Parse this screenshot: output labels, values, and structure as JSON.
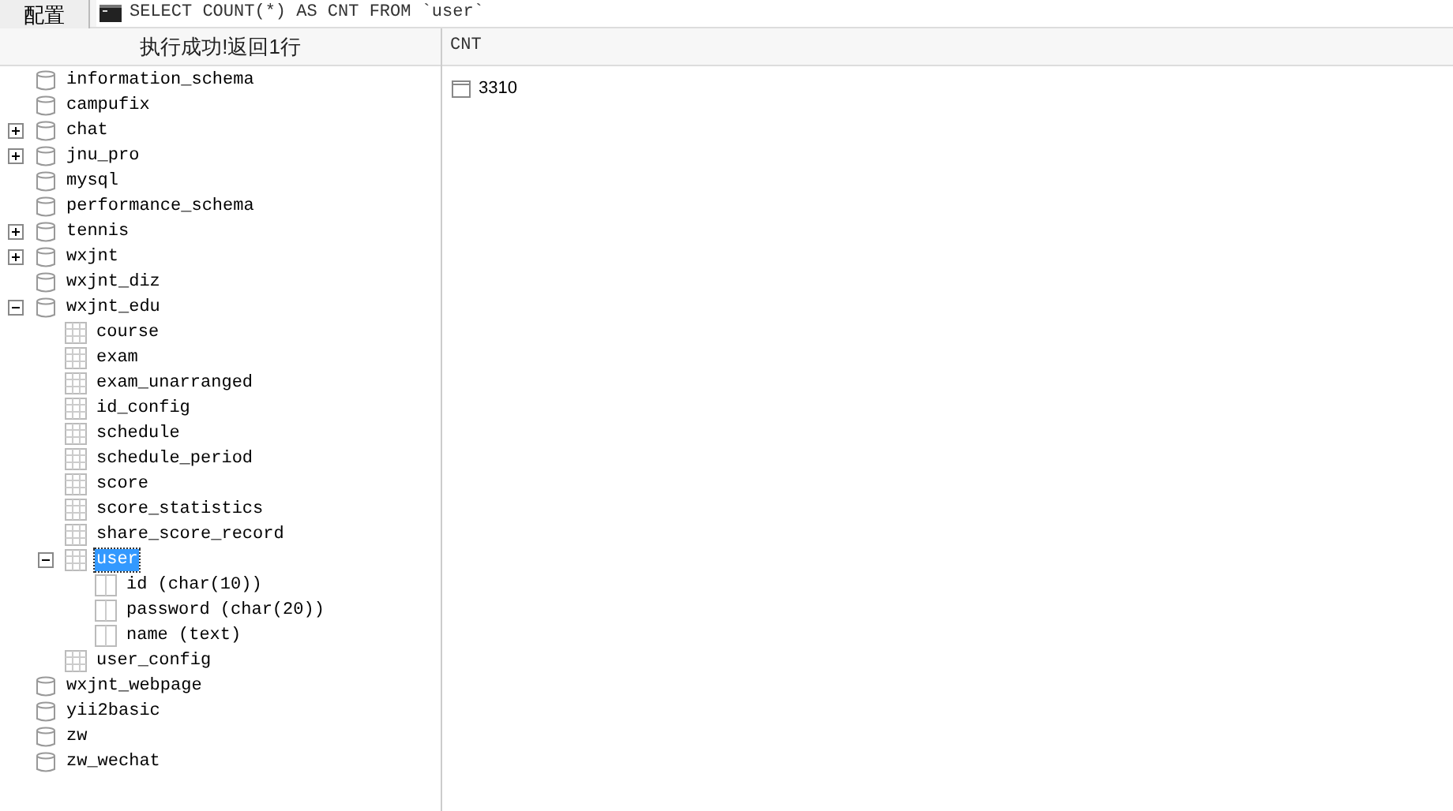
{
  "toolbar": {
    "config_button": "配置",
    "query": "SELECT COUNT(*) AS CNT FROM `user`"
  },
  "status": "执行成功!返回1行",
  "tree": [
    {
      "kind": "database",
      "label": "information_schema",
      "selected": false
    },
    {
      "kind": "database",
      "label": "campufix",
      "selected": false
    },
    {
      "kind": "database",
      "label": "chat",
      "selected": false,
      "expanded": false
    },
    {
      "kind": "database",
      "label": "jnu_pro",
      "selected": false,
      "expanded": false
    },
    {
      "kind": "database",
      "label": "mysql",
      "selected": false
    },
    {
      "kind": "database",
      "label": "performance_schema",
      "selected": false
    },
    {
      "kind": "database",
      "label": "tennis",
      "selected": false,
      "expanded": false
    },
    {
      "kind": "database",
      "label": "wxjnt",
      "selected": false,
      "expanded": false
    },
    {
      "kind": "database",
      "label": "wxjnt_diz",
      "selected": false
    },
    {
      "kind": "database",
      "label": "wxjnt_edu",
      "selected": false,
      "expanded": true,
      "children": [
        {
          "kind": "table",
          "label": "course",
          "selected": false
        },
        {
          "kind": "table",
          "label": "exam",
          "selected": false
        },
        {
          "kind": "table",
          "label": "exam_unarranged",
          "selected": false
        },
        {
          "kind": "table",
          "label": "id_config",
          "selected": false
        },
        {
          "kind": "table",
          "label": "schedule",
          "selected": false
        },
        {
          "kind": "table",
          "label": "schedule_period",
          "selected": false
        },
        {
          "kind": "table",
          "label": "score",
          "selected": false
        },
        {
          "kind": "table",
          "label": "score_statistics",
          "selected": false
        },
        {
          "kind": "table",
          "label": "share_score_record",
          "selected": false
        },
        {
          "kind": "table",
          "label": "user",
          "selected": true,
          "expanded": true,
          "children": [
            {
              "kind": "column",
              "label": "id (char(10))",
              "selected": false
            },
            {
              "kind": "column",
              "label": "password (char(20))",
              "selected": false
            },
            {
              "kind": "column",
              "label": "name (text)",
              "selected": false
            }
          ]
        },
        {
          "kind": "table",
          "label": "user_config",
          "selected": false
        }
      ]
    },
    {
      "kind": "database",
      "label": "wxjnt_webpage",
      "selected": false
    },
    {
      "kind": "database",
      "label": "yii2basic",
      "selected": false
    },
    {
      "kind": "database",
      "label": "zw",
      "selected": false
    },
    {
      "kind": "database",
      "label": "zw_wechat",
      "selected": false
    }
  ],
  "result": {
    "columns": [
      "CNT"
    ],
    "rows": [
      [
        "3310"
      ]
    ]
  }
}
